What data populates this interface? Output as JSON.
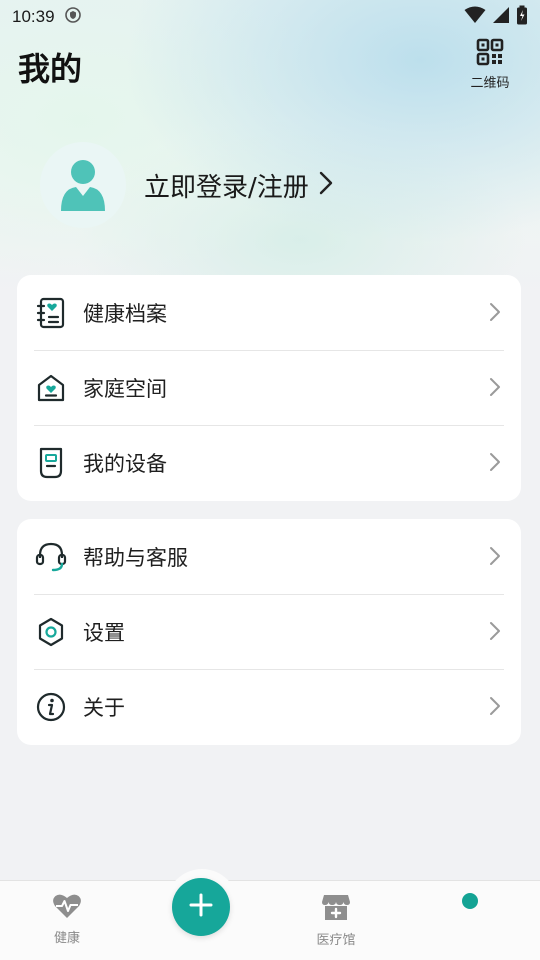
{
  "status_bar": {
    "time": "10:39"
  },
  "header": {
    "title": "我的",
    "qr_label": "二维码"
  },
  "profile": {
    "login_label": "立即登录/注册"
  },
  "menu_group_1": [
    {
      "label": "健康档案",
      "icon": "health-record-icon"
    },
    {
      "label": "家庭空间",
      "icon": "family-home-icon"
    },
    {
      "label": "我的设备",
      "icon": "device-icon"
    }
  ],
  "menu_group_2": [
    {
      "label": "帮助与客服",
      "icon": "headset-icon"
    },
    {
      "label": "设置",
      "icon": "settings-icon"
    },
    {
      "label": "关于",
      "icon": "info-icon"
    }
  ],
  "bottom_nav": {
    "health_label": "健康",
    "clinic_label": "医疗馆"
  },
  "colors": {
    "accent": "#16a79a",
    "nav_inactive": "#8a8a8a"
  }
}
